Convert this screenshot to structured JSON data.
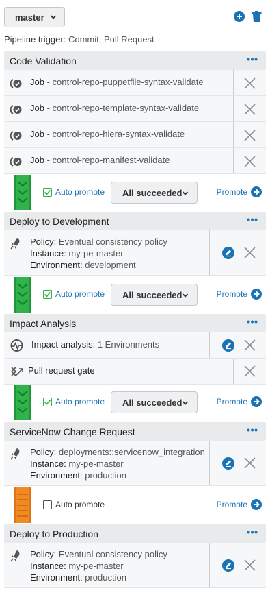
{
  "header": {
    "branch": "master",
    "add_icon": "plus-circle-icon",
    "delete_icon": "trash-icon"
  },
  "trigger": {
    "label": "Pipeline trigger:",
    "value": "Commit, Pull Request"
  },
  "stages": [
    {
      "title": "Code Validation",
      "jobs": [
        {
          "label": "Job",
          "name": " - control-repo-puppetfile-syntax-validate"
        },
        {
          "label": "Job",
          "name": " - control-repo-template-syntax-validate"
        },
        {
          "label": "Job",
          "name": " - control-repo-hiera-syntax-validate"
        },
        {
          "label": "Job",
          "name": " - control-repo-manifest-validate"
        }
      ]
    },
    {
      "title": "Deploy to Development",
      "deployment": {
        "policy_label": "Policy:",
        "policy": "Eventual consistency policy",
        "instance_label": "Instance:",
        "instance": "my-pe-master",
        "env_label": "Environment:",
        "env": "development"
      }
    },
    {
      "title": "Impact Analysis",
      "impact": {
        "label": "Impact analysis:",
        "value": "1 Environments"
      },
      "gate": {
        "label": "Pull request gate"
      }
    },
    {
      "title": "ServiceNow Change Request",
      "deployment": {
        "policy_label": "Policy:",
        "policy": "deployments::servicenow_integration",
        "instance_label": "Instance:",
        "instance": "my-pe-master",
        "env_label": "Environment:",
        "env": "production"
      }
    },
    {
      "title": "Deploy to Production",
      "deployment": {
        "policy_label": "Policy:",
        "policy": "Eventual consistency policy",
        "instance_label": "Instance:",
        "instance": "my-pe-master",
        "env_label": "Environment:",
        "env": "production"
      }
    }
  ],
  "gates": [
    {
      "auto_promote": "Auto promote",
      "checked": true,
      "condition": "All succeeded",
      "promote": "Promote",
      "color": "#2fb34a"
    },
    {
      "auto_promote": "Auto promote",
      "checked": true,
      "condition": "All succeeded",
      "promote": "Promote",
      "color": "#2fb34a"
    },
    {
      "auto_promote": "Auto promote",
      "checked": true,
      "condition": "All succeeded",
      "promote": "Promote",
      "color": "#2fb34a"
    },
    {
      "auto_promote": "Auto promote",
      "checked": false,
      "promote": "Promote",
      "color": "#f08a24"
    }
  ],
  "colors": {
    "accent": "#1a73b5",
    "success_green": "#2fb34a",
    "pending_orange": "#f08a24"
  }
}
